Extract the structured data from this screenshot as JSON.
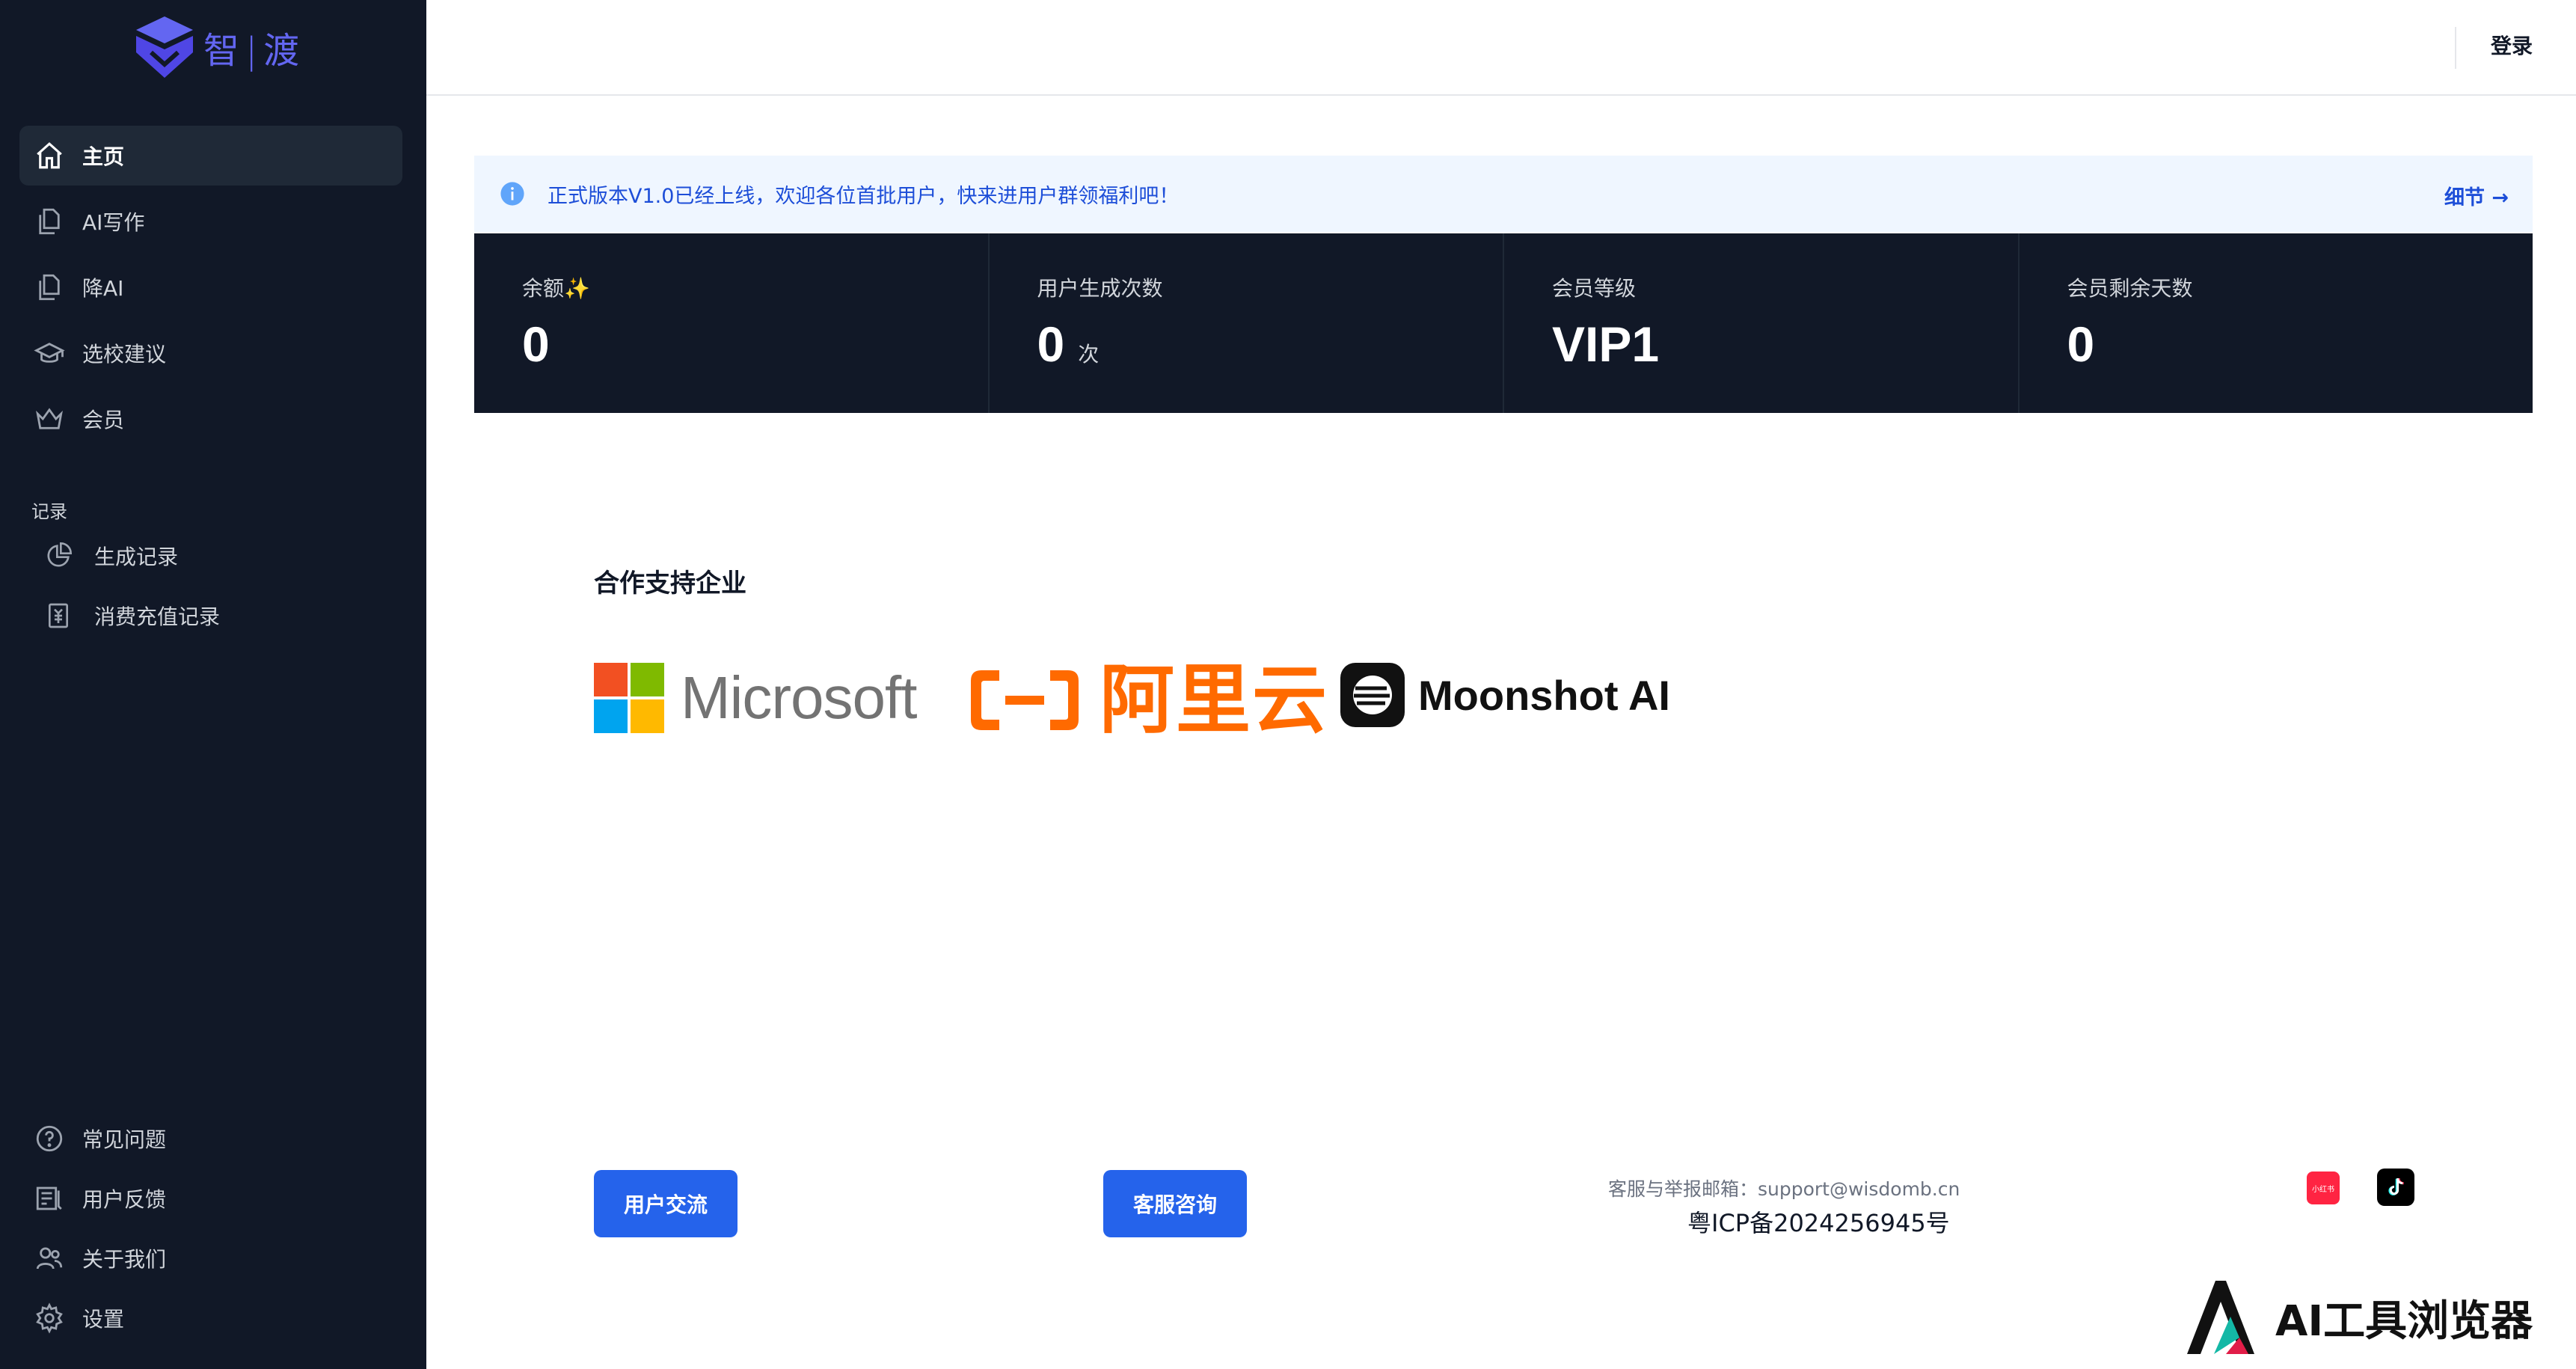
{
  "brand": {
    "name_a": "智",
    "name_b": "渡",
    "color": "#6366f1"
  },
  "sidebar": {
    "items": [
      {
        "label": "主页",
        "icon": "home-icon"
      },
      {
        "label": "AI写作",
        "icon": "document-icon"
      },
      {
        "label": "降AI",
        "icon": "document-copy-icon"
      },
      {
        "label": "选校建议",
        "icon": "graduation-cap-icon"
      },
      {
        "label": "会员",
        "icon": "crown-icon"
      }
    ],
    "section_label": "记录",
    "records": [
      {
        "label": "生成记录",
        "icon": "pie-chart-icon"
      },
      {
        "label": "消费充值记录",
        "icon": "receipt-icon"
      }
    ],
    "bottom": [
      {
        "label": "常见问题",
        "icon": "question-circle-icon"
      },
      {
        "label": "用户反馈",
        "icon": "feedback-icon"
      },
      {
        "label": "关于我们",
        "icon": "users-icon"
      },
      {
        "label": "设置",
        "icon": "gear-icon"
      }
    ]
  },
  "header": {
    "login": "登录"
  },
  "banner": {
    "text": "正式版本V1.0已经上线，欢迎各位首批用户，快来进用户群领福利吧！",
    "link": "细节 →"
  },
  "stats": [
    {
      "label": "余额✨",
      "value": "0",
      "unit": ""
    },
    {
      "label": "用户生成次数",
      "value": "0",
      "unit": "次"
    },
    {
      "label": "会员等级",
      "value": "VIP1",
      "unit": ""
    },
    {
      "label": "会员剩余天数",
      "value": "0",
      "unit": ""
    }
  ],
  "partners": {
    "title": "合作支持企业",
    "microsoft": "Microsoft",
    "aliyun": "阿里云",
    "moonshot": "Moonshot AI"
  },
  "footer": {
    "btn_community": "用户交流",
    "btn_support": "客服咨询",
    "email": "客服与举报邮箱：support@wisdomb.cn",
    "icp": "粤ICP备2024256945号",
    "social_red_label": "小红书"
  },
  "watermark": {
    "text": "AI工具浏览器"
  },
  "colors": {
    "sidebar_bg": "#111827",
    "primary": "#2563eb",
    "banner_text": "#1d4ed8",
    "aliyun": "#ff6a00"
  }
}
